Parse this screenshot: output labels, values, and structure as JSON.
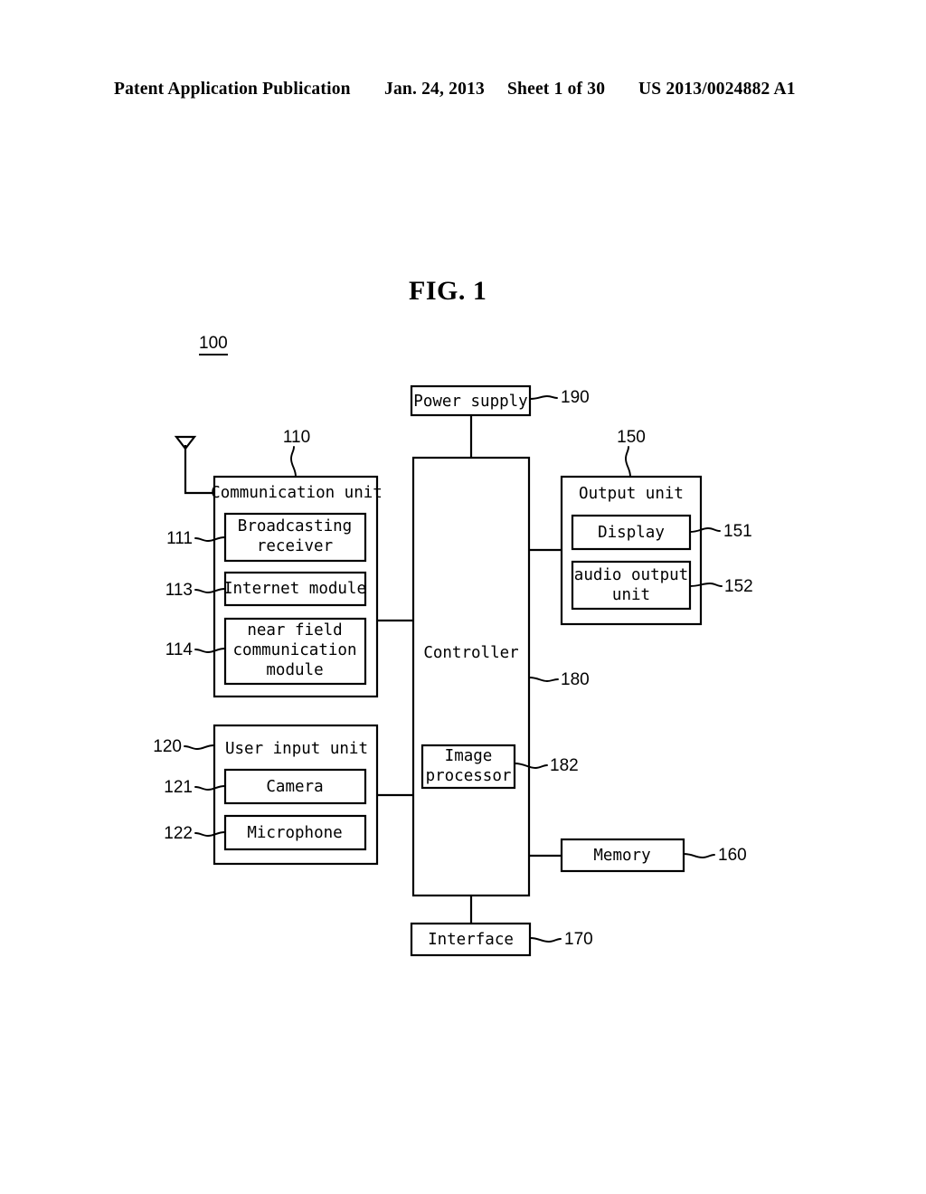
{
  "header": {
    "publication": "Patent Application Publication",
    "date": "Jan. 24, 2013",
    "sheet": "Sheet 1 of 30",
    "patent_number": "US 2013/0024882 A1"
  },
  "figure": {
    "title": "FIG. 1",
    "system_ref": "100"
  },
  "blocks": {
    "power_supply": {
      "label": "Power supply",
      "ref": "190"
    },
    "controller": {
      "label": "Controller",
      "ref": "180"
    },
    "image_processor": {
      "label": "Image\nprocessor",
      "line1": "Image",
      "line2": "processor",
      "ref": "182"
    },
    "communication_unit": {
      "label": "Communication unit",
      "ref": "110"
    },
    "broadcasting_receiver": {
      "line1": "Broadcasting",
      "line2": "receiver",
      "ref": "111"
    },
    "internet_module": {
      "label": "Internet module",
      "ref": "113"
    },
    "near_field_module": {
      "line1": "near field",
      "line2": "communication",
      "line3": "module",
      "ref": "114"
    },
    "user_input_unit": {
      "label": "User input unit",
      "ref": "120"
    },
    "camera": {
      "label": "Camera",
      "ref": "121"
    },
    "microphone": {
      "label": "Microphone",
      "ref": "122"
    },
    "output_unit": {
      "label": "Output unit",
      "ref": "150"
    },
    "display": {
      "label": "Display",
      "ref": "151"
    },
    "audio_output_unit": {
      "line1": "audio output",
      "line2": "unit",
      "ref": "152"
    },
    "memory": {
      "label": "Memory",
      "ref": "160"
    },
    "interface": {
      "label": "Interface",
      "ref": "170"
    }
  },
  "symbols": {
    "antenna": "antenna-symbol"
  }
}
